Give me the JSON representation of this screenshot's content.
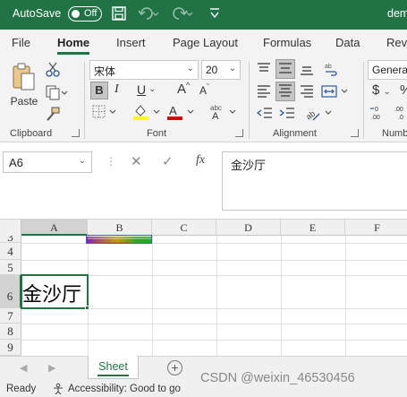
{
  "titlebar": {
    "autosave_label": "AutoSave",
    "autosave_state": "Off",
    "doc_name": "dem"
  },
  "ribbon_tabs": [
    "File",
    "Home",
    "Insert",
    "Page Layout",
    "Formulas",
    "Data",
    "Revi"
  ],
  "active_tab": "Home",
  "ribbon": {
    "clipboard": {
      "paste_label": "Paste",
      "group_label": "Clipboard"
    },
    "font": {
      "font_name": "宋体",
      "font_size": "20",
      "group_label": "Font",
      "bold": "B",
      "italic": "I",
      "underline": "U",
      "grow": "A",
      "shrink": "A",
      "highlight_color": "#ffff00",
      "font_color": "#e00000"
    },
    "alignment": {
      "group_label": "Alignment"
    },
    "number": {
      "format": "General",
      "group_label": "Numb"
    }
  },
  "formula_bar": {
    "name_box": "A6",
    "fx_label": "fx",
    "content": "金沙厅"
  },
  "grid": {
    "columns": [
      "A",
      "B",
      "C",
      "D",
      "E",
      "F"
    ],
    "rows": [
      "3",
      "4",
      "5",
      "6",
      "7",
      "8",
      "9"
    ],
    "selected_cell": "A6",
    "cell_a6": "金沙厅"
  },
  "sheets": [
    "Sheet"
  ],
  "status": {
    "ready": "Ready",
    "accessibility": "Accessibility: Good to go"
  },
  "watermark": "CSDN @weixin_46530456",
  "colors": {
    "accent": "#217346"
  }
}
